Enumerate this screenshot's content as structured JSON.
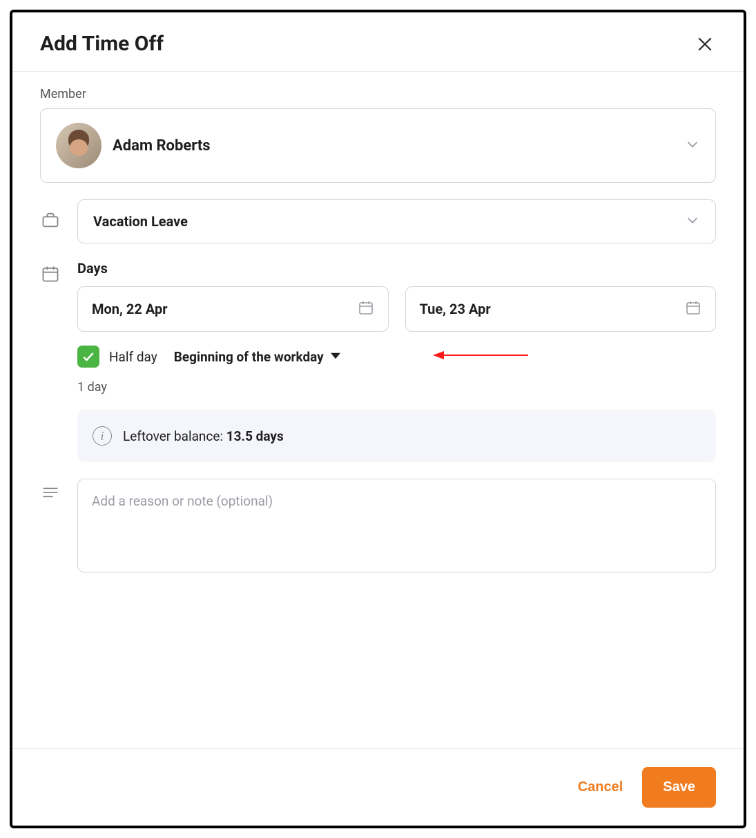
{
  "header": {
    "title": "Add Time Off"
  },
  "member": {
    "label": "Member",
    "name": "Adam Roberts"
  },
  "leave": {
    "type": "Vacation Leave"
  },
  "days": {
    "heading": "Days",
    "start": "Mon, 22 Apr",
    "end": "Tue, 23 Apr",
    "half_day_label": "Half day",
    "half_day_checked": true,
    "half_day_option": "Beginning of the workday",
    "duration": "1 day"
  },
  "balance": {
    "label": "Leftover balance: ",
    "value": "13.5 days"
  },
  "note": {
    "placeholder": "Add a reason or note (optional)"
  },
  "footer": {
    "cancel": "Cancel",
    "save": "Save"
  }
}
